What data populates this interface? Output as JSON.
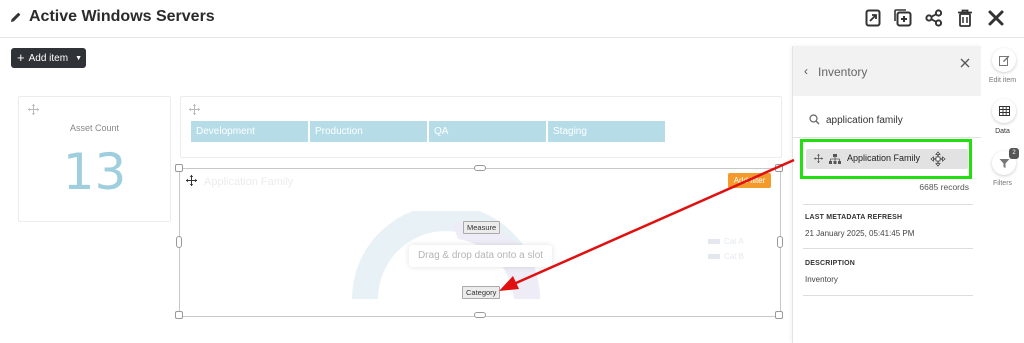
{
  "header": {
    "title": "Active Windows Servers",
    "icons": [
      "edit-pencil-icon",
      "export-icon",
      "add-copy-icon",
      "share-icon",
      "delete-icon",
      "close-icon"
    ]
  },
  "toolbar": {
    "add_item_label": "Add item"
  },
  "asset_card": {
    "label": "Asset Count",
    "value": "13"
  },
  "tabs_widget": {
    "cells": [
      "Development",
      "Production",
      "QA",
      "Staging"
    ]
  },
  "gauge_widget": {
    "faded_title": "Application Family",
    "add_filter_label": "Add filter",
    "measure_label": "Measure",
    "category_label": "Category",
    "drag_hint": "Drag & drop data onto a slot",
    "legend": [
      "Cat A",
      "Cat B"
    ],
    "colors": {
      "gauge_arc": "#e8f2f6",
      "gauge_arc_inner": "#eeecf6",
      "accent_filter": "#f39a2a"
    }
  },
  "inventory_panel": {
    "title": "Inventory",
    "search_value": "application family",
    "field": {
      "label": "Application Family",
      "icon": "hierarchy-icon"
    },
    "records": "6685 records",
    "metadata_heading": "LAST METADATA REFRESH",
    "metadata_value": "21 January 2025, 05:41:45 PM",
    "description_heading": "DESCRIPTION",
    "description_value": "Inventory"
  },
  "side_rail": {
    "items": [
      {
        "label": "Edit item",
        "icon": "edit-item-icon"
      },
      {
        "label": "Data",
        "icon": "table-icon"
      },
      {
        "label": "Filters",
        "icon": "filter-icon",
        "badge": "2"
      }
    ]
  },
  "annotations": {
    "highlight_color": "#22e00f",
    "arrow_color": "#e01010"
  }
}
